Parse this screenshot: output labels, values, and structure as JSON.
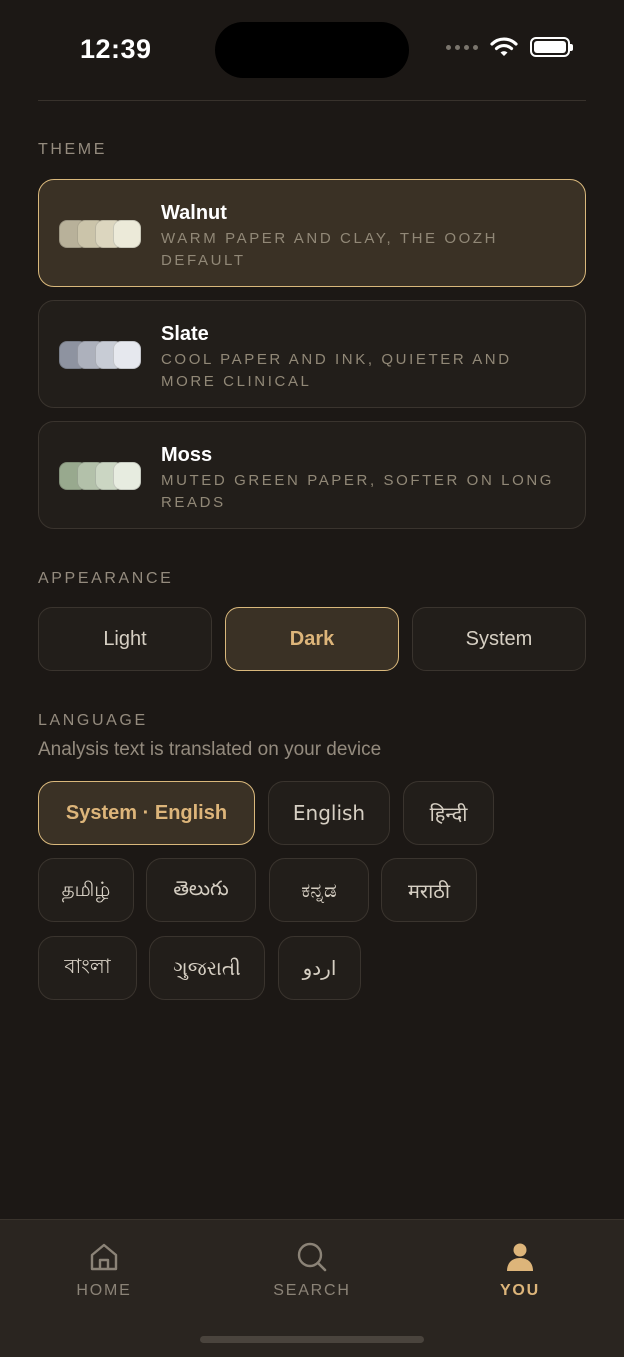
{
  "status": {
    "time": "12:39"
  },
  "theme": {
    "label": "THEME",
    "options": [
      {
        "name": "Walnut",
        "description": "WARM PAPER AND CLAY, THE OOZH DEFAULT",
        "selected": true,
        "swatches": [
          "#b8b19a",
          "#cbc4aa",
          "#dcd6bf",
          "#ecead9"
        ]
      },
      {
        "name": "Slate",
        "description": "COOL PAPER AND INK, QUIETER AND MORE CLINICAL",
        "selected": false,
        "swatches": [
          "#8e93a0",
          "#adb1bc",
          "#c8ccd5",
          "#e6e8ee"
        ]
      },
      {
        "name": "Moss",
        "description": "MUTED GREEN PAPER, SOFTER ON LONG READS",
        "selected": false,
        "swatches": [
          "#98a98e",
          "#b3c1aa",
          "#cbd6c3",
          "#e7ece0"
        ]
      }
    ]
  },
  "appearance": {
    "label": "APPEARANCE",
    "options": [
      {
        "label": "Light",
        "selected": false
      },
      {
        "label": "Dark",
        "selected": true
      },
      {
        "label": "System",
        "selected": false
      }
    ]
  },
  "language": {
    "label": "LANGUAGE",
    "subtitle": "Analysis text is translated on your device",
    "options": [
      {
        "label": "System · English",
        "selected": true
      },
      {
        "label": "English",
        "selected": false
      },
      {
        "label": "हिन्दी",
        "selected": false
      },
      {
        "label": "தமிழ்",
        "selected": false
      },
      {
        "label": "తెలుగు",
        "selected": false
      },
      {
        "label": "ಕನ್ನಡ",
        "selected": false
      },
      {
        "label": "मराठी",
        "selected": false
      },
      {
        "label": "বাংলা",
        "selected": false
      },
      {
        "label": "ગુજરાતી",
        "selected": false
      },
      {
        "label": "اردو",
        "selected": false
      }
    ]
  },
  "tabs": [
    {
      "label": "HOME",
      "icon": "home-icon",
      "active": false
    },
    {
      "label": "SEARCH",
      "icon": "search-icon",
      "active": false
    },
    {
      "label": "YOU",
      "icon": "person-icon",
      "active": true
    }
  ],
  "colors": {
    "accent": "#ddb57a",
    "accent_border": "#d9b87c",
    "background": "#1c1815"
  }
}
